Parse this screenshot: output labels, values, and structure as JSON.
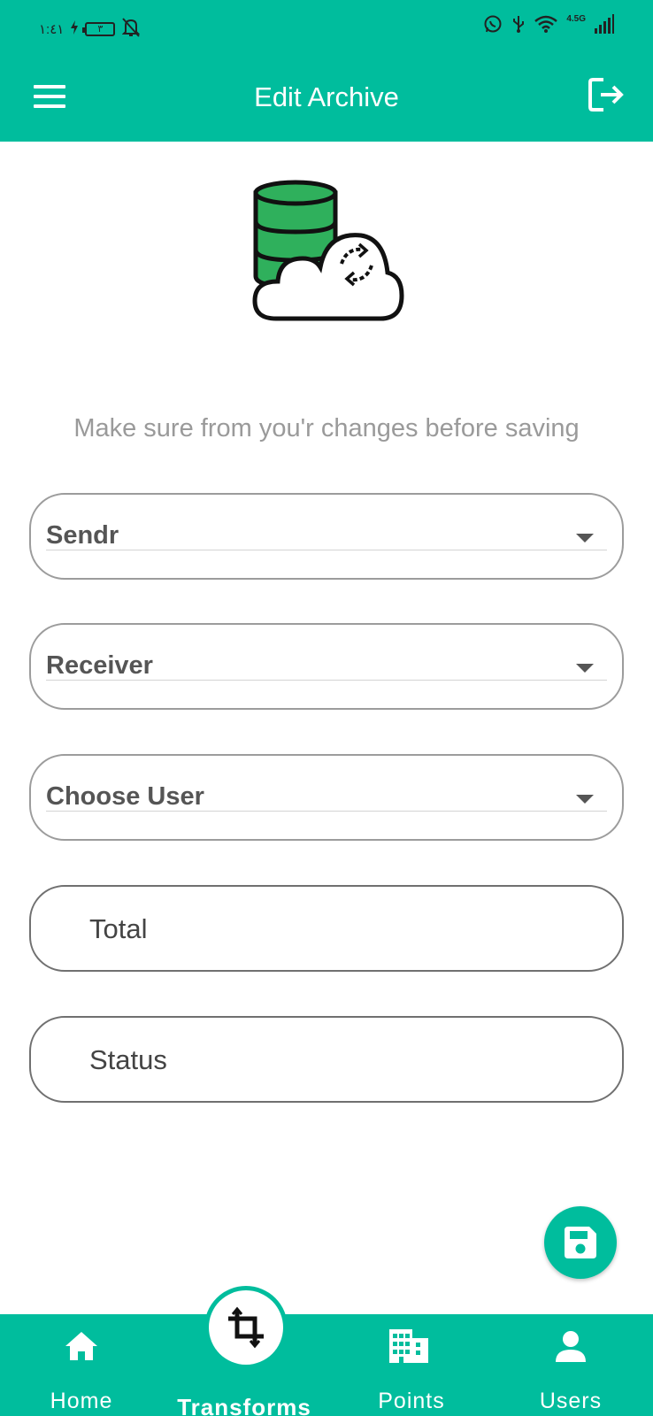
{
  "status_bar": {
    "time": "١:٤١",
    "battery": "٣",
    "network": "4.5G"
  },
  "app_bar": {
    "title": "Edit Archive"
  },
  "hint": "Make sure  from you'r changes before saving",
  "form": {
    "sender": {
      "label": "Sendr"
    },
    "receiver": {
      "label": "Receiver"
    },
    "user": {
      "label": "Choose User"
    },
    "total": {
      "placeholder": "Total"
    },
    "status": {
      "placeholder": "Status"
    }
  },
  "bottom_nav": {
    "items": [
      {
        "label": "Home",
        "icon": "home-icon"
      },
      {
        "label": "Transforms",
        "icon": "crop-icon",
        "active": true
      },
      {
        "label": "Points",
        "icon": "building-icon"
      },
      {
        "label": "Users",
        "icon": "person-icon"
      }
    ]
  },
  "colors": {
    "primary": "#00bd9d",
    "database_green": "#2fb05c",
    "hint_text": "#9a9a9a"
  }
}
